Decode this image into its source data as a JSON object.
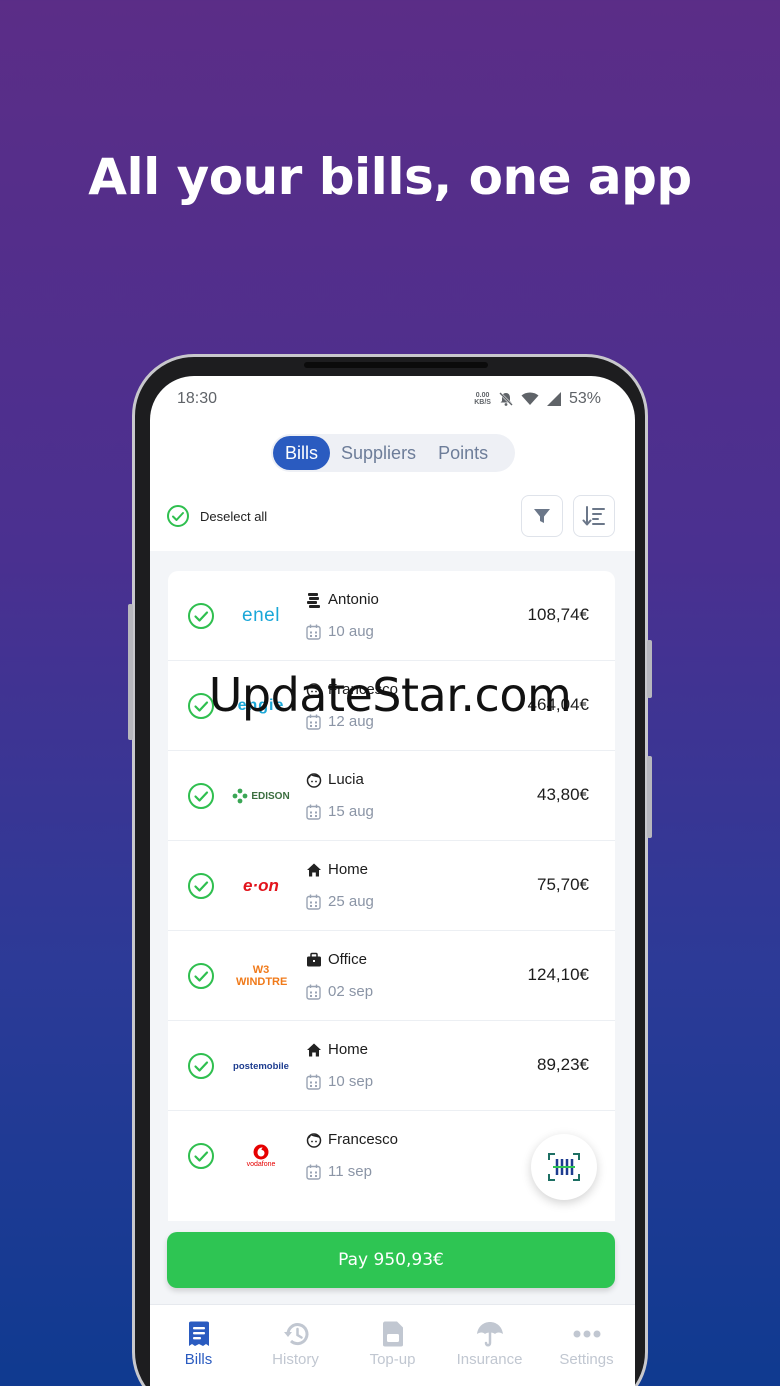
{
  "headline": "All your bills, one app",
  "watermark": "UpdateStar.com",
  "status": {
    "time": "18:30",
    "net_top": "0.00",
    "net_bottom": "KB/S",
    "battery": "53%"
  },
  "tabs": [
    {
      "label": "Bills",
      "active": true
    },
    {
      "label": "Suppliers"
    },
    {
      "label": "Points"
    }
  ],
  "toolbar": {
    "deselect_label": "Deselect all"
  },
  "bills": [
    {
      "supplier": "enel",
      "owner": "Antonio",
      "owner_icon": "coins-icon",
      "date": "10 aug",
      "amount": "108,74€"
    },
    {
      "supplier": "engie",
      "owner": "Francesco",
      "owner_icon": "avatar-icon",
      "date": "12 aug",
      "amount": "464,04€"
    },
    {
      "supplier": "EDISON",
      "owner": "Lucia",
      "owner_icon": "avatar-icon",
      "date": "15 aug",
      "amount": "43,80€"
    },
    {
      "supplier": "e·on",
      "owner": "Home",
      "owner_icon": "home-icon",
      "date": "25 aug",
      "amount": "75,70€"
    },
    {
      "supplier": "W3 WINDTRE",
      "owner": "Office",
      "owner_icon": "briefcase-icon",
      "date": "02 sep",
      "amount": "124,10€"
    },
    {
      "supplier": "postemobile",
      "owner": "Home",
      "owner_icon": "home-icon",
      "date": "10 sep",
      "amount": "89,23€"
    },
    {
      "supplier": "vodafone",
      "owner": "Francesco",
      "owner_icon": "avatar-icon",
      "date": "11 sep",
      "amount": ""
    }
  ],
  "pay_button": "Pay 950,93€",
  "nav": [
    {
      "label": "Bills",
      "icon": "bill-icon",
      "active": true
    },
    {
      "label": "History",
      "icon": "history-icon"
    },
    {
      "label": "Top-up",
      "icon": "sim-icon"
    },
    {
      "label": "Insurance",
      "icon": "umbrella-icon"
    },
    {
      "label": "Settings",
      "icon": "more-icon"
    }
  ],
  "colors": {
    "accent": "#2a5bc0",
    "success": "#2ec553",
    "check": "#2fbf4f",
    "bg_top": "#5b2d87",
    "bg_bottom": "#0f3a90"
  }
}
